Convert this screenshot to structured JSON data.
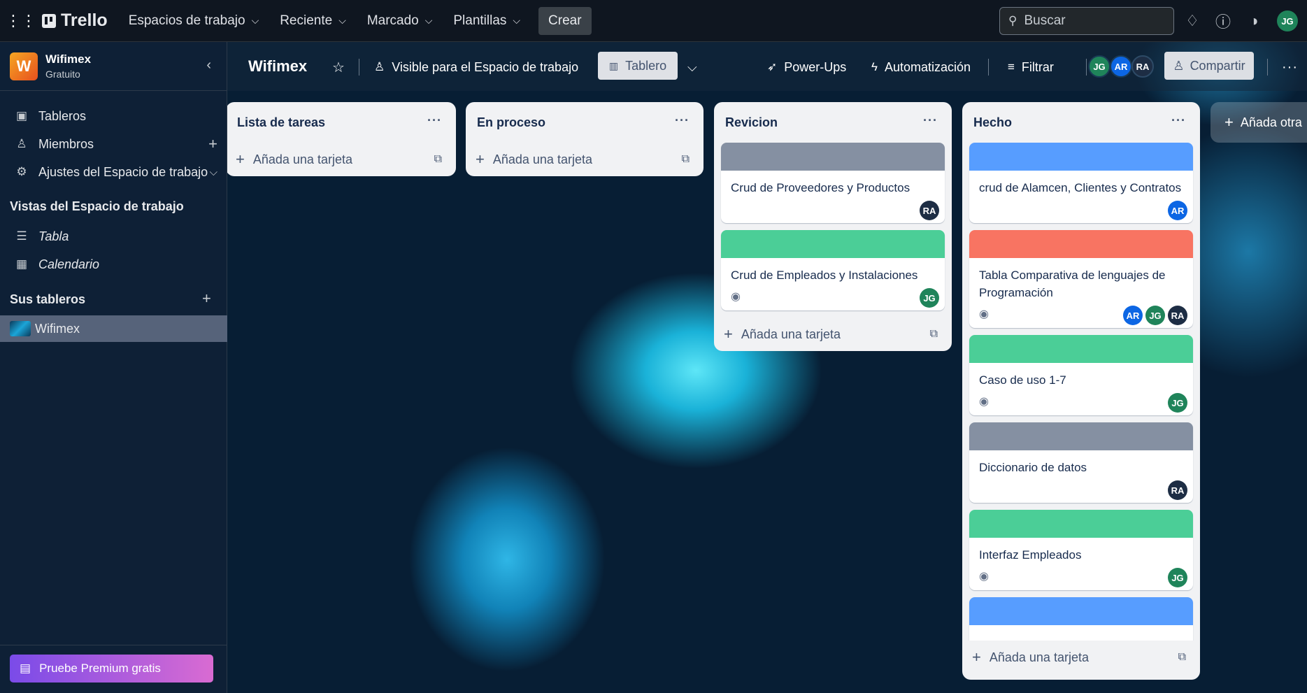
{
  "topbar": {
    "brand": "Trello",
    "nav": [
      "Espacios de trabajo",
      "Reciente",
      "Marcado",
      "Plantillas"
    ],
    "create": "Crear",
    "search_placeholder": "Buscar",
    "user_initials": "JG"
  },
  "sidebar": {
    "workspace_initial": "W",
    "workspace_name": "Wifimex",
    "workspace_plan": "Gratuito",
    "items": [
      "Tableros",
      "Miembros",
      "Ajustes del Espacio de trabajo"
    ],
    "views_header": "Vistas del Espacio de trabajo",
    "views": [
      "Tabla",
      "Calendario"
    ],
    "boards_header": "Sus tableros",
    "boards": [
      "Wifimex"
    ],
    "premium": "Pruebe Premium gratis"
  },
  "board": {
    "title": "Wifimex",
    "visibility": "Visible para el Espacio de trabajo",
    "view": "Tablero",
    "powerups": "Power-Ups",
    "automation": "Automatización",
    "filter": "Filtrar",
    "members": [
      "JG",
      "AR",
      "RA"
    ],
    "share": "Compartir",
    "add_list": "Añada otra",
    "add_card": "Añada una tarjeta"
  },
  "lists": [
    {
      "title": "Lista de tareas",
      "cards": []
    },
    {
      "title": "En proceso",
      "cards": []
    },
    {
      "title": "Revicion",
      "cards": [
        {
          "title": "Crud de Proveedores y Productos",
          "cover": "#8590a2",
          "watch": false,
          "members": [
            "RA"
          ]
        },
        {
          "title": "Crud de Empleados y Instalaciones",
          "cover": "#4bce97",
          "watch": true,
          "members": [
            "JG"
          ]
        }
      ]
    },
    {
      "title": "Hecho",
      "cards": [
        {
          "title": "crud de Alamcen, Clientes y Contratos",
          "cover": "#579dff",
          "watch": false,
          "members": [
            "AR"
          ]
        },
        {
          "title": "Tabla Comparativa de lenguajes de Programación",
          "cover": "#f87462",
          "watch": true,
          "members": [
            "AR",
            "JG",
            "RA"
          ]
        },
        {
          "title": "Caso de uso 1-7",
          "cover": "#4bce97",
          "watch": true,
          "members": [
            "JG"
          ]
        },
        {
          "title": "Diccionario de datos",
          "cover": "#8590a2",
          "watch": false,
          "members": [
            "RA"
          ]
        },
        {
          "title": "Interfaz Empleados",
          "cover": "#4bce97",
          "watch": true,
          "members": [
            "JG"
          ]
        },
        {
          "title": "",
          "cover": "#579dff",
          "watch": false,
          "members": []
        }
      ]
    }
  ]
}
